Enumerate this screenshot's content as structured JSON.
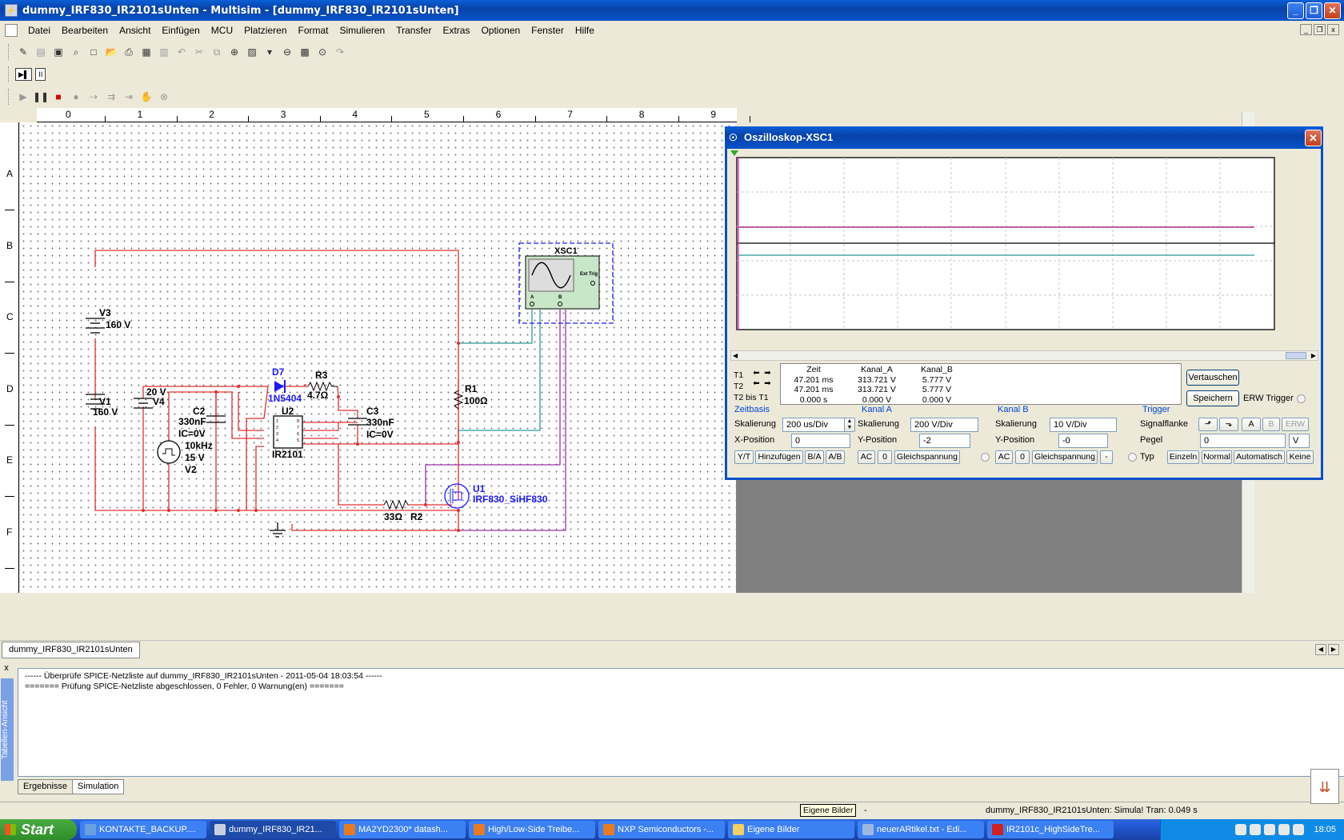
{
  "window": {
    "title": "dummy_IRF830_IR2101sUnten - Multisim - [dummy_IRF830_IR2101sUnten]",
    "minimize": "_",
    "maximize": "❐",
    "close": "✕"
  },
  "menu": [
    "Datei",
    "Bearbeiten",
    "Ansicht",
    "Einfügen",
    "MCU",
    "Platzieren",
    "Format",
    "Simulieren",
    "Transfer",
    "Extras",
    "Optionen",
    "Fenster",
    "Hilfe"
  ],
  "mdi": {
    "min": "_",
    "restore": "❐",
    "close": "x"
  },
  "toolbar_sim_chip": "II",
  "ruler": {
    "top_numbers": [
      "0",
      "1",
      "2",
      "3",
      "4",
      "5",
      "6",
      "7",
      "8",
      "9"
    ],
    "left_letters": [
      "A",
      "B",
      "C",
      "D",
      "E",
      "F"
    ]
  },
  "schematic": {
    "V3": "V3",
    "V3_val": "160 V",
    "V1": "V1",
    "V1_val": "160 V",
    "V4": "V4",
    "V4_val": "20 V",
    "C2": "C2",
    "C2_val": "330nF",
    "C2_ic": "IC=0V",
    "V2_freq": "10kHz",
    "V2_amp": "15 V",
    "V2": "V2",
    "D7": "D7",
    "D7_part": "1N5404",
    "R3": "R3",
    "R3_val": "4.7Ω",
    "U2": "U2",
    "U2_part": "IR2101",
    "C3": "C3",
    "C3_val": "330nF",
    "C3_ic": "IC=0V",
    "R1": "R1",
    "R1_val": "100Ω",
    "R2": "R2",
    "R2_val": "33Ω",
    "U1": "U1",
    "U1_part": "IRF830_SiHF830",
    "XSC1": "XSC1",
    "ext_trig": "Ext Trig",
    "ch_a": "A",
    "ch_b": "B",
    "wire_color": "#e03030",
    "teal_wire": "#2a9a9a",
    "purple_wire": "#9a30a8",
    "part_blue": "#1a1aff"
  },
  "doc_tab": "dummy_IRF830_IR2101sUnten",
  "output": {
    "side_label": "Tabellen-Ansicht",
    "close": "x",
    "lines": [
      "------ Überprüfe SPICE-Netzliste auf dummy_IRF830_IR2101sUnten - 2011-05-04 18:03:54 ------",
      "======= Prüfung SPICE-Netzliste abgeschlossen, 0 Fehler, 0 Warnung(en) ======="
    ],
    "tabs": [
      "Ergebnisse",
      "Simulation"
    ]
  },
  "status": {
    "hint": "Eigene Bilder",
    "dash": "-",
    "sim": "dummy_IRF830_IR2101sUnten: Simula! Tran: 0.049 s"
  },
  "scope": {
    "title": "Oszilloskop-XSC1",
    "trace_a_color": "#b0308c",
    "trace_b_color": "#2a9a9a",
    "readout": {
      "headers": [
        "Zeit",
        "Kanal_A",
        "Kanal_B"
      ],
      "row_labels": [
        "T1",
        "T2",
        "T2 bis T1"
      ],
      "zeit": [
        "47.201 ms",
        "47.201 ms",
        "0.000 s"
      ],
      "kanal_a": [
        "313.721 V",
        "313.721 V",
        "0.000 V"
      ],
      "kanal_b": [
        "5.777 V",
        "5.777 V",
        "0.000 V"
      ]
    },
    "buttons": {
      "vertauschen": "Vertauschen",
      "speichern": "Speichern",
      "erw_trigger": "ERW Trigger"
    },
    "zeitbasis": {
      "title": "Zeitbasis",
      "skalierung_label": "Skalierung",
      "skalierung": "200 us/Div",
      "xpos_label": "X-Position",
      "xpos": "0",
      "modes": [
        "Y/T",
        "Hinzufügen",
        "B/A",
        "A/B"
      ]
    },
    "kanal_a": {
      "title": "Kanal A",
      "skalierung_label": "Skalierung",
      "skalierung": "200  V/Div",
      "ypos_label": "Y-Position",
      "ypos": "-2",
      "coupling": [
        "AC",
        "0",
        "Gleichspannung"
      ]
    },
    "kanal_b": {
      "title": "Kanal B",
      "skalierung_label": "Skalierung",
      "skalierung": "10  V/Div",
      "ypos_label": "Y-Position",
      "ypos": "-0",
      "coupling": [
        "AC",
        "0",
        "Gleichspannung",
        "-"
      ]
    },
    "trigger": {
      "title": "Trigger",
      "flanke_label": "Signalflanke",
      "flanken": [
        "⬏",
        "⬎",
        "A",
        "B",
        "ERW"
      ],
      "pegel_label": "Pegel",
      "pegel": "0",
      "pegel_unit": "V",
      "typ_label": "Typ",
      "types": [
        "Einzeln",
        "Normal",
        "Automatisch",
        "Keine"
      ]
    }
  },
  "taskbar": {
    "start": "Start",
    "tasks": [
      "KONTAKTE_BACKUP....",
      "dummy_IRF830_IR21...",
      "MA2YD2300* datash...",
      "High/Low-Side Treibe...",
      "NXP Semiconductors -...",
      "Eigene Bilder",
      "neuerARtikel.txt - Edi...",
      "IR2101c_HighSideTre..."
    ],
    "clock": "18:05"
  }
}
